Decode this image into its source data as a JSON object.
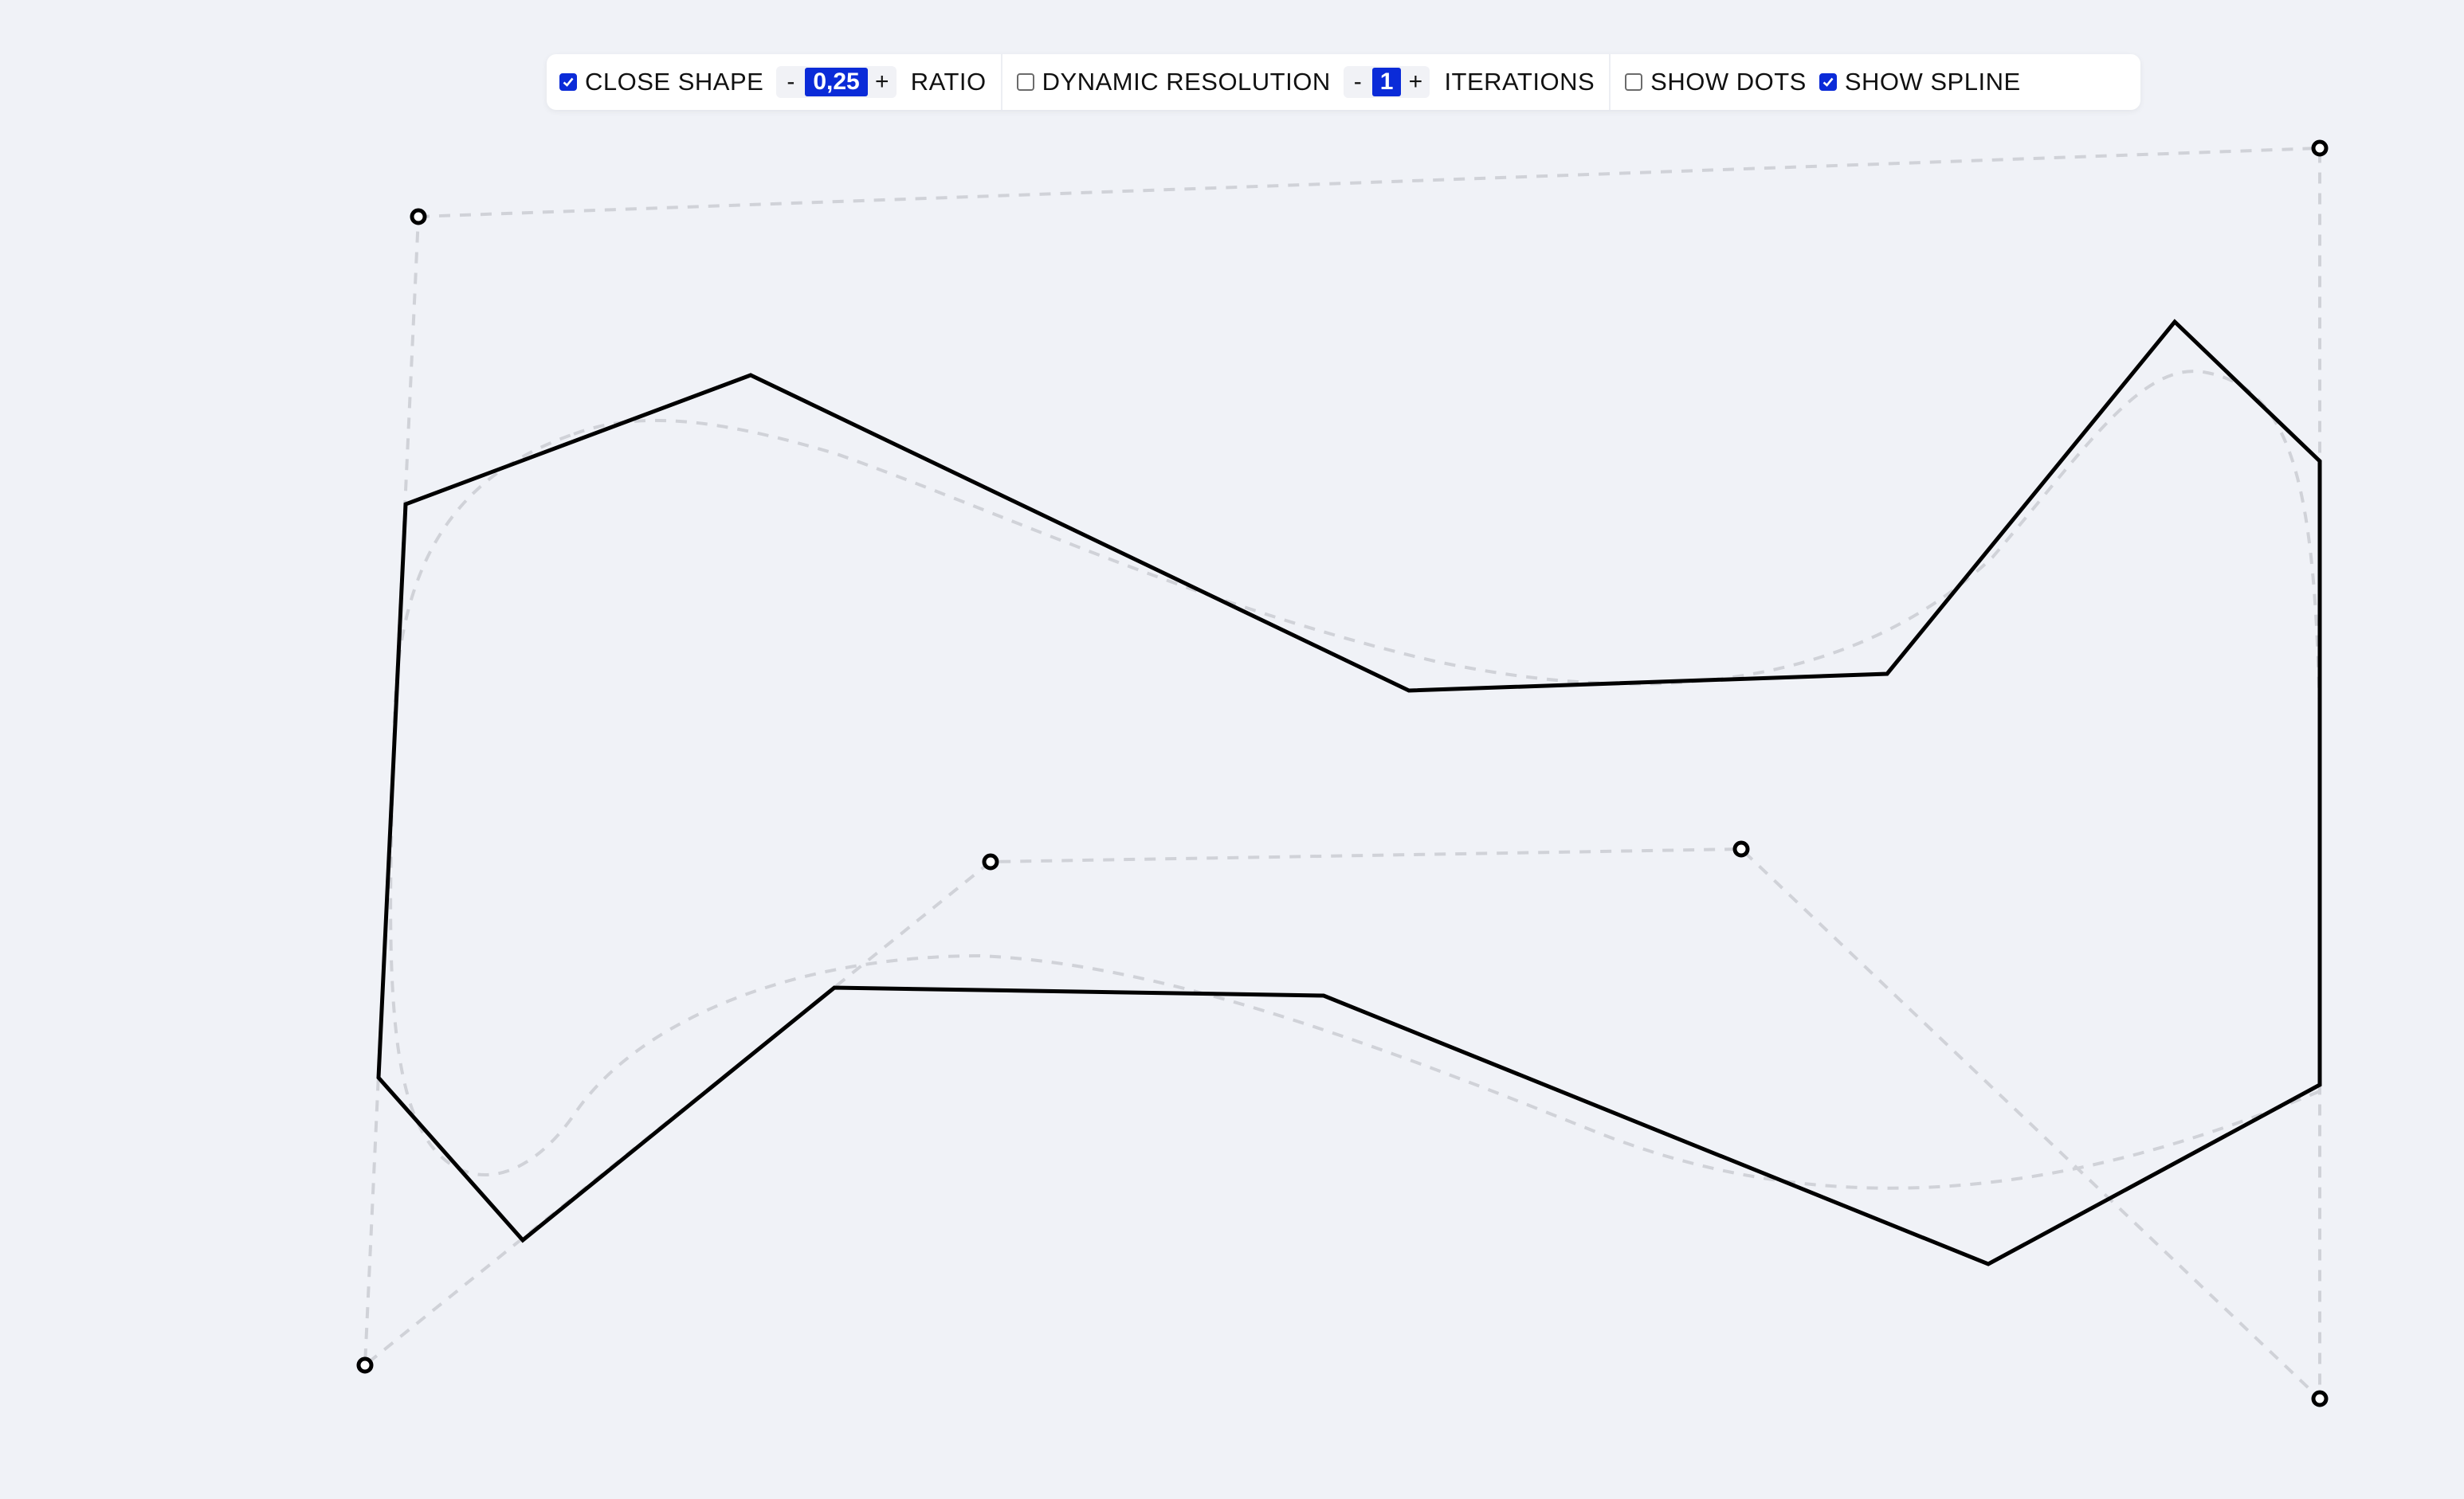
{
  "toolbar": {
    "close_shape": {
      "label": "CLOSE SHAPE",
      "checked": true
    },
    "ratio": {
      "minus": "-",
      "value": "0,25",
      "plus": "+",
      "label": "RATIO"
    },
    "dynamic_resolution": {
      "label": "DYNAMIC RESOLUTION",
      "checked": false
    },
    "iterations": {
      "minus": "-",
      "value": "1",
      "plus": "+",
      "label": "ITERATIONS"
    },
    "show_dots": {
      "label": "SHOW DOTS",
      "checked": false
    },
    "show_spline": {
      "label": "SHOW SPLINE",
      "checked": true
    }
  },
  "colors": {
    "background": "#f0f2f7",
    "accent": "#0b2bd8",
    "shape_stroke": "#000000",
    "guide_stroke": "#d0d2d8"
  }
}
